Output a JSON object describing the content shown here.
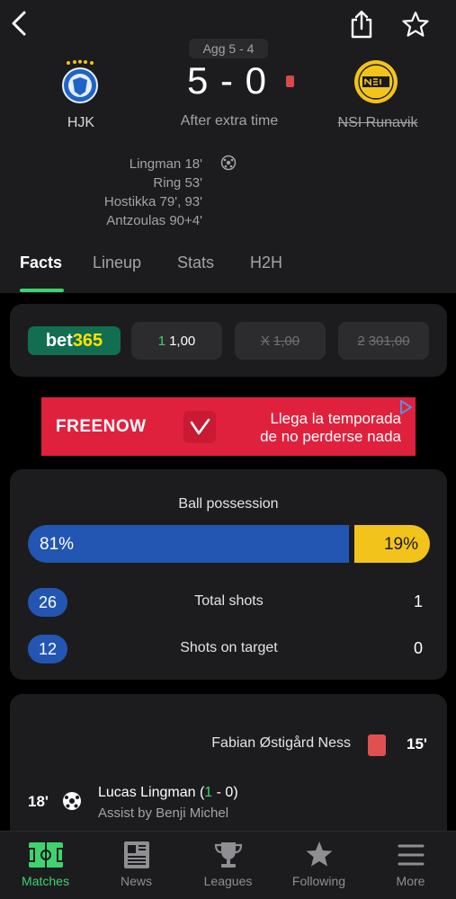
{
  "match": {
    "aggregate": "Agg 5 - 4",
    "home_team": "HJK",
    "away_team": "NSI Runavik",
    "score": "5 - 0",
    "status": "After extra time",
    "scorers": [
      "Lingman 18'",
      "Ring 53'",
      "Hostikka 79', 93'",
      "Antzoulas 90+4'"
    ]
  },
  "tabs": [
    {
      "label": "Facts",
      "active": true
    },
    {
      "label": "Lineup"
    },
    {
      "label": "Stats"
    },
    {
      "label": "H2H"
    }
  ],
  "odds": {
    "brand_part1": "bet",
    "brand_part2": "365",
    "home": {
      "label": "1",
      "value": "1,00"
    },
    "draw": {
      "label": "X",
      "value": "1,00"
    },
    "away": {
      "label": "2",
      "value": "301,00"
    }
  },
  "ad": {
    "brand": "FREENOW",
    "line1": "Llega la temporada",
    "line2": "de no perderse nada"
  },
  "stats": {
    "possession_title": "Ball possession",
    "possession_home": "81%",
    "possession_away": "19%",
    "possession_home_fraction": 0.81,
    "rows": [
      {
        "label": "Total shots",
        "home": "26",
        "away": "1"
      },
      {
        "label": "Shots on target",
        "home": "12",
        "away": "0"
      }
    ]
  },
  "events": {
    "red_card": {
      "player": "Fabian Østigård Ness",
      "minute": "15'"
    },
    "goal": {
      "minute": "18'",
      "player": "Lucas Lingman",
      "score_open": "(",
      "score_home": "1",
      "score_rest": " - 0)",
      "assist": "Assist by Benji Michel"
    }
  },
  "bottom_nav": [
    {
      "label": "Matches",
      "icon": "pitch-icon",
      "active": true
    },
    {
      "label": "News",
      "icon": "newspaper-icon"
    },
    {
      "label": "Leagues",
      "icon": "trophy-icon"
    },
    {
      "label": "Following",
      "icon": "star-icon"
    },
    {
      "label": "More",
      "icon": "menu-icon"
    }
  ],
  "colors": {
    "accent_green": "#3fd26f",
    "home_blue": "#2356b3",
    "away_yellow": "#f2c31b",
    "card_bg": "#1c1c1e",
    "red_card": "#e05050",
    "ad_red": "#e0213d"
  }
}
